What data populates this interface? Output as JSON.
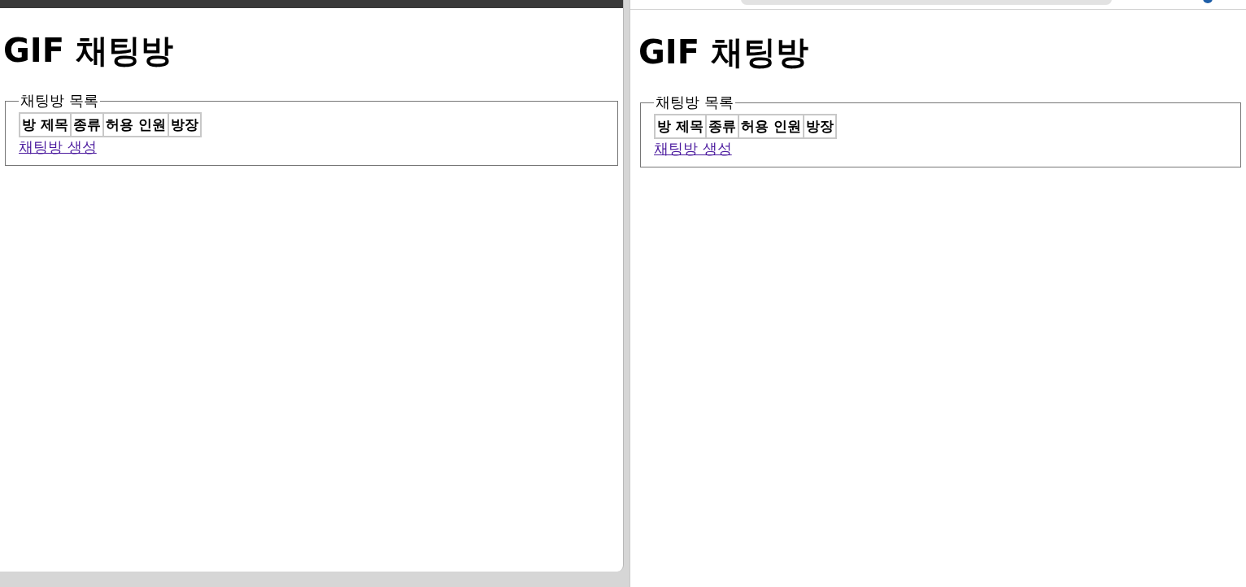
{
  "windows": [
    {
      "kind": "dark-frame",
      "heading": "GIF 채팅방",
      "legend": "채팅방 목록",
      "columns": [
        "방 제목",
        "종류",
        "허용 인원",
        "방장"
      ],
      "link": "채팅방 생성"
    },
    {
      "kind": "browser-toolbar",
      "heading": "GIF 채팅방",
      "legend": "채팅방 목록",
      "columns": [
        "방 제목",
        "종류",
        "허용 인원",
        "방장"
      ],
      "link": "채팅방 생성"
    }
  ]
}
